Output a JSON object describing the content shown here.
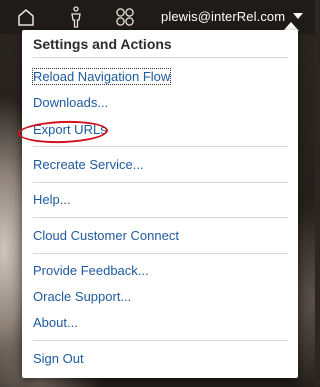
{
  "header": {
    "user_label": "plewis@interRel.com",
    "icons": [
      "home-icon",
      "person-icon",
      "apps-icon",
      "chevron-down-icon"
    ]
  },
  "menu": {
    "title": "Settings and Actions",
    "items": [
      {
        "label": "Reload Navigation Flow",
        "focused": true
      },
      {
        "label": "Downloads..."
      },
      {
        "label": "Export URLs",
        "annotated": true
      },
      {
        "label": "Recreate Service..."
      },
      {
        "label": "Help..."
      },
      {
        "label": "Cloud Customer Connect"
      },
      {
        "label": "Provide Feedback..."
      },
      {
        "label": "Oracle Support..."
      },
      {
        "label": "About..."
      },
      {
        "label": "Sign Out"
      }
    ]
  },
  "colors": {
    "link": "#1f5a9e",
    "annotation": "#d3101d"
  }
}
